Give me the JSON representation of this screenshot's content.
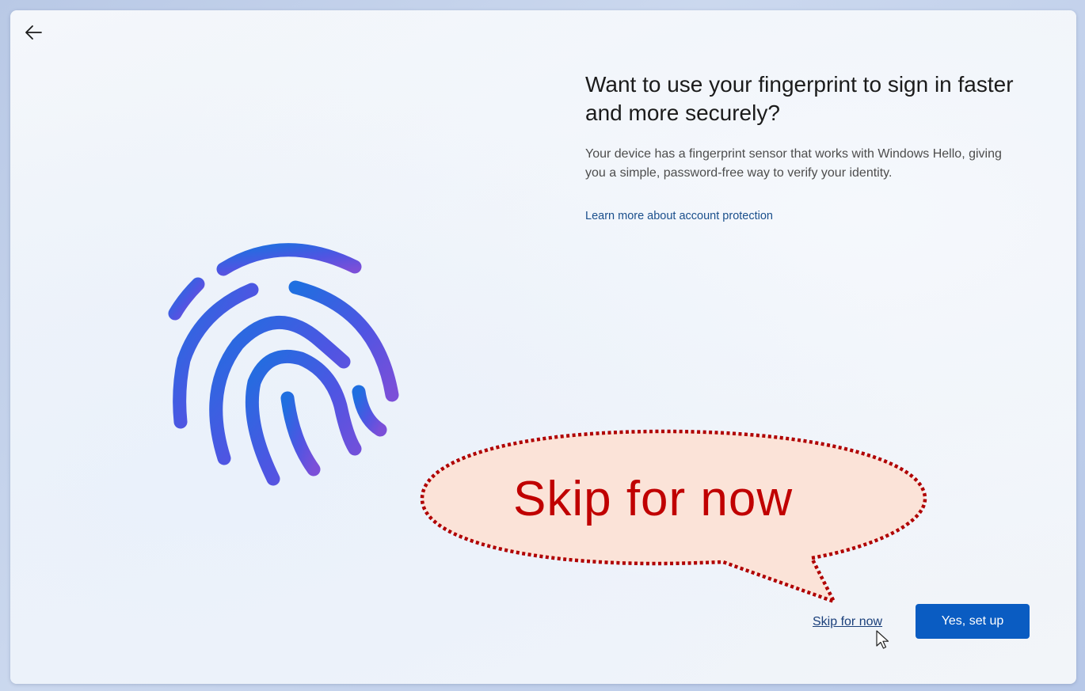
{
  "header": {
    "back_icon": "arrow-left-icon"
  },
  "illustration": {
    "icon": "fingerprint-icon",
    "gradient_colors": [
      "#1f6fe0",
      "#5a4ae0",
      "#7b4fd8"
    ]
  },
  "main": {
    "title": "Want to use your fingerprint to sign in faster and more securely?",
    "description": "Your device has a fingerprint sensor that works with Windows Hello, giving you a simple, password-free way to verify your identity.",
    "learn_more_link": "Learn more about account protection"
  },
  "callout": {
    "text": "Skip for now",
    "text_color": "#c00000",
    "fill_color": "#fbe3d8",
    "border_color": "#b00000"
  },
  "actions": {
    "skip_label": "Skip for now",
    "primary_label": "Yes, set up",
    "primary_color": "#0a5cc2"
  },
  "cursor": {
    "icon": "mouse-pointer-icon"
  }
}
